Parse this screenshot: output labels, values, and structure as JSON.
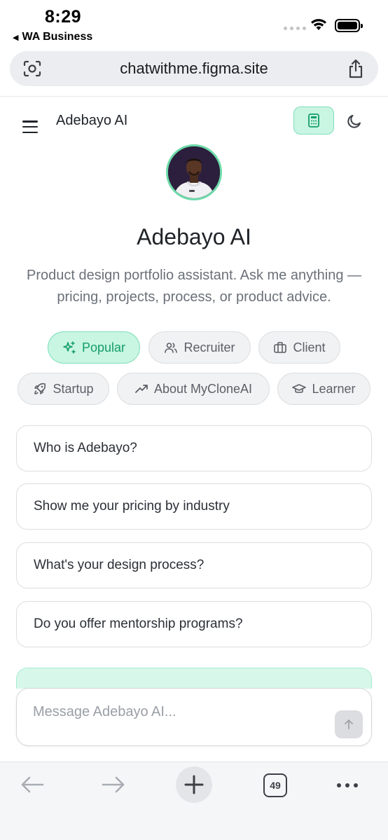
{
  "status_bar": {
    "time": "8:29",
    "back_app": "WA Business"
  },
  "browser": {
    "url": "chatwithme.figma.site",
    "tab_count": "49"
  },
  "app": {
    "header_title": "Adebayo AI",
    "hero_title": "Adebayo AI",
    "hero_subtitle": "Product design portfolio assistant. Ask me anything — pricing, projects, process, or product advice.",
    "accent_color": "#10b981"
  },
  "chips": [
    {
      "label": "Popular",
      "icon": "sparkles-icon",
      "active": true
    },
    {
      "label": "Recruiter",
      "icon": "users-icon",
      "active": false
    },
    {
      "label": "Client",
      "icon": "briefcase-icon",
      "active": false
    },
    {
      "label": "Startup",
      "icon": "rocket-icon",
      "active": false
    },
    {
      "label": "About MyCloneAI",
      "icon": "trending-up-icon",
      "active": false
    },
    {
      "label": "Learner",
      "icon": "graduation-cap-icon",
      "active": false
    }
  ],
  "suggestions": [
    "Who is Adebayo?",
    "Show me your pricing by industry",
    "What's your design process?",
    "Do you offer mentorship programs?"
  ],
  "composer": {
    "placeholder": "Message Adebayo AI..."
  }
}
